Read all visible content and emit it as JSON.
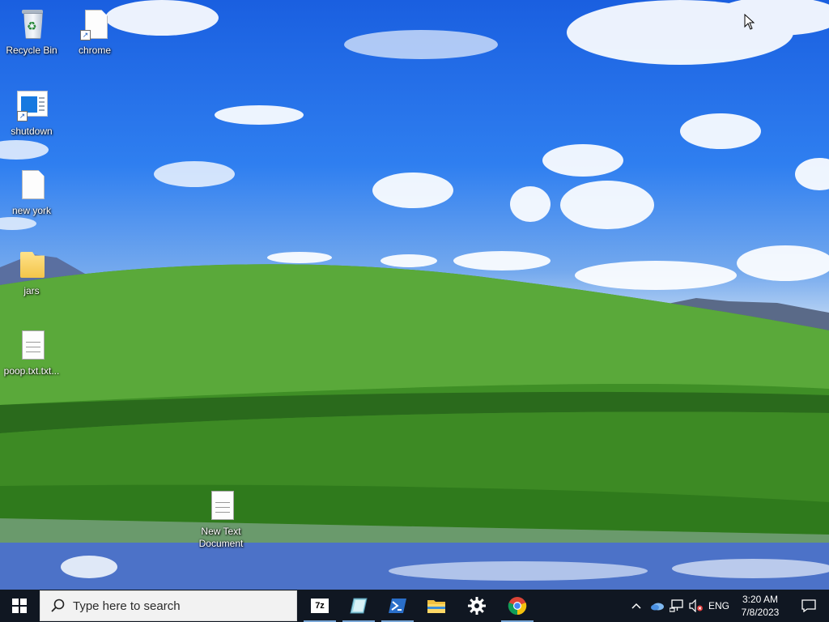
{
  "desktop": {
    "icons": [
      {
        "label": "Recycle Bin",
        "icon": "recycle-bin-icon"
      },
      {
        "label": "chrome",
        "icon": "chrome-shortcut-icon"
      },
      {
        "label": "shutdown",
        "icon": "shutdown-shortcut-icon"
      },
      {
        "label": "new york",
        "icon": "blank-file-icon"
      },
      {
        "label": "jars",
        "icon": "folder-icon"
      },
      {
        "label": "poop.txt.txt...",
        "icon": "text-file-icon"
      },
      {
        "label": "New Text Document",
        "icon": "text-file-icon"
      }
    ]
  },
  "taskbar": {
    "search_placeholder": "Type here to search",
    "pinned": [
      {
        "name": "7-Zip",
        "glyph": "7z",
        "active": true
      },
      {
        "name": "Notepad",
        "active": true
      },
      {
        "name": "PowerShell",
        "active": true
      },
      {
        "name": "File Explorer",
        "active": false
      },
      {
        "name": "Settings",
        "active": false
      },
      {
        "name": "Google Chrome",
        "active": true
      }
    ],
    "tray": {
      "language": "ENG",
      "time": "3:20 AM",
      "date": "7/8/2023"
    }
  },
  "colors": {
    "taskbar_bg": "#101722",
    "accent": "#7aa8d8",
    "sky": "#2f7ff0",
    "hill": "#4f9a2a"
  }
}
